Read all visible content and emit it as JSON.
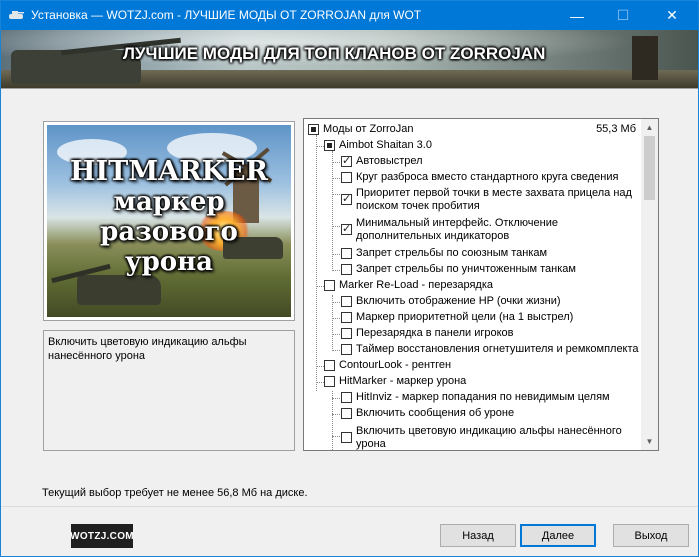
{
  "window": {
    "title": "Установка — WOTZJ.com - ЛУЧШИЕ МОДЫ ОТ ZORROJAN для WOT",
    "controls": {
      "minimize": "—",
      "maximize": "☐",
      "close": "✕"
    }
  },
  "banner": {
    "text": "ЛУЧШИЕ МОДЫ ДЛЯ ТОП КЛАНОВ ОТ ZORROJAN"
  },
  "preview": {
    "lines": [
      "HITMARKER",
      "маркер",
      "разового",
      "урона"
    ]
  },
  "description": "Включить цветовую индикацию альфы нанесённого урона",
  "components": {
    "root": {
      "label": "Моды от ZorroJan",
      "size": "55,3 Мб"
    },
    "items": [
      {
        "label": "Aimbot Shaitan 3.0"
      },
      {
        "label": "Автовыстрел"
      },
      {
        "label": "Круг разброса вместо стандартного круга сведения"
      },
      {
        "label": "Приоритет первой точки в месте захвата прицела над поиском точек пробития"
      },
      {
        "label": "Минимальный интерфейс. Отключение дополнительных индикаторов"
      },
      {
        "label": "Запрет стрельбы по союзным танкам"
      },
      {
        "label": "Запрет стрельбы по уничтоженным танкам"
      },
      {
        "label": "Marker Re-Load - перезарядка"
      },
      {
        "label": "Включить отображение HP (очки жизни)"
      },
      {
        "label": "Маркер приоритетной цели (на 1 выстрел)"
      },
      {
        "label": "Перезарядка в панели игроков"
      },
      {
        "label": "Таймер восстановления огнетушителя и ремкомплекта"
      },
      {
        "label": "ContourLook - рентген"
      },
      {
        "label": "HitMarker - маркер урона"
      },
      {
        "label": "HitInviz - маркер попадания по невидимым целям"
      },
      {
        "label": "Включить сообщения об уроне"
      },
      {
        "label": "Включить цветовую индикацию альфы нанесённого урона"
      }
    ]
  },
  "disk_info": "Текущий выбор требует не менее 56,8 Мб на диске.",
  "brand": "WOTZJ.COM",
  "buttons": {
    "back": "Назад",
    "next": "Далее",
    "exit": "Выход"
  },
  "scrollbar": {
    "up": "▲",
    "down": "▼"
  },
  "colors": {
    "titlebar": "#0078d7",
    "window_bg": "#f0f0f0",
    "default_button_border": "#0078d7"
  }
}
